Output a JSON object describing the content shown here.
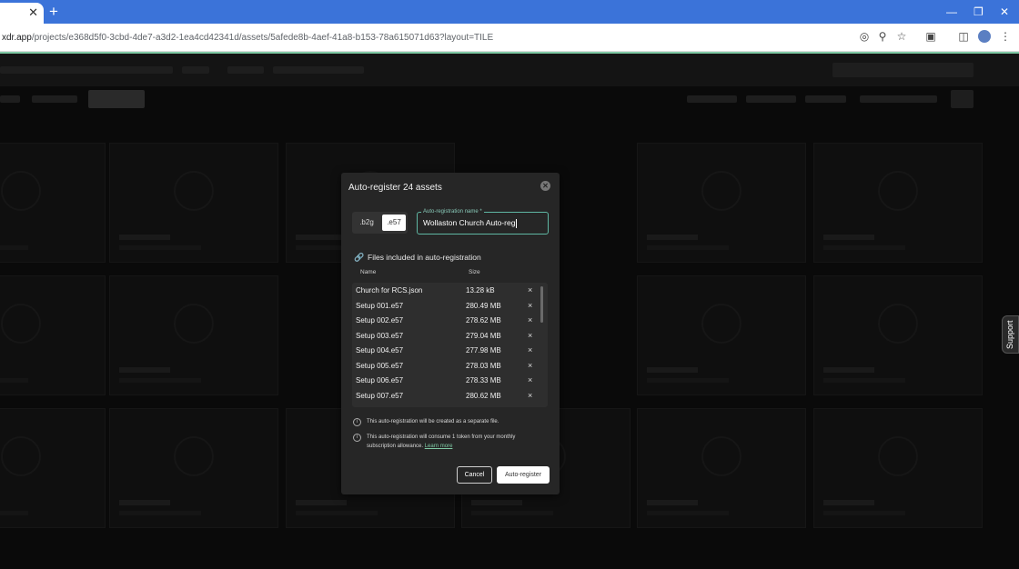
{
  "browser": {
    "tab_close": "✕",
    "new_tab": "+",
    "url_host": "xdr.app",
    "url_path": "/projects/e368d5f0-3cbd-4de7-a3d2-1ea4cd42341d/assets/5afede8b-4aef-41a8-b153-78a615071d63?layout=TILE",
    "controls": {
      "minimize": "—",
      "restore": "❐",
      "close": "✕"
    },
    "toolbar_icons": [
      "location-icon",
      "zoom-icon",
      "star-icon",
      "extensions-icon",
      "side-panel-icon",
      "profile-icon",
      "menu-icon"
    ]
  },
  "support": {
    "label": "Support"
  },
  "modal": {
    "title": "Auto-register 24 assets",
    "close_icon": "✕",
    "format_toggle": {
      "option_1": ".b2g",
      "option_2": ".e57",
      "selected": ".e57"
    },
    "name_field": {
      "label": "Auto-registration name *",
      "value": "Wollaston Church Auto-reg"
    },
    "files_heading": "Files included in auto-registration",
    "columns": {
      "name": "Name",
      "size": "Size"
    },
    "files": [
      {
        "name": "Church for RCS.json",
        "size": "13.28 kB"
      },
      {
        "name": "Setup 001.e57",
        "size": "280.49 MB"
      },
      {
        "name": "Setup 002.e57",
        "size": "278.62 MB"
      },
      {
        "name": "Setup 003.e57",
        "size": "279.04 MB"
      },
      {
        "name": "Setup 004.e57",
        "size": "277.98 MB"
      },
      {
        "name": "Setup 005.e57",
        "size": "278.03 MB"
      },
      {
        "name": "Setup 006.e57",
        "size": "278.33 MB"
      },
      {
        "name": "Setup 007.e57",
        "size": "280.62 MB"
      }
    ],
    "remove_icon": "×",
    "info_1": "This auto-registration will be created as a separate file.",
    "info_2": "This auto-registration will consume 1 token from your monthly subscription allowance.",
    "learn_more": "Learn more",
    "cancel_label": "Cancel",
    "submit_label": "Auto-register"
  }
}
